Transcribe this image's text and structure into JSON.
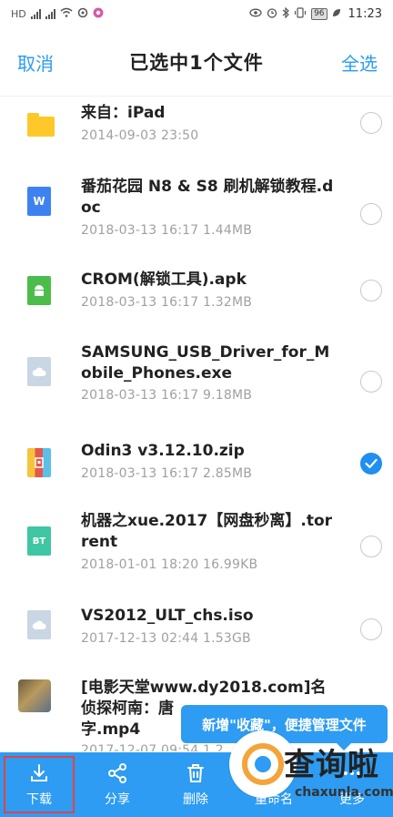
{
  "status_bar": {
    "left_indicators": [
      "HD",
      "4G",
      "4G",
      "wifi",
      "sync",
      "app"
    ],
    "battery": "96",
    "time": "11:23"
  },
  "header": {
    "cancel": "取消",
    "title": "已选中1个文件",
    "select_all": "全选"
  },
  "files": [
    {
      "name": "来自：iPad",
      "meta": "2014-09-03  23:50",
      "icon": "folder-icon",
      "selected": false
    },
    {
      "name": "番茄花园 N8 & S8 刷机解锁教程.doc",
      "meta": "2018-03-13  16:17   1.44MB",
      "icon": "doc-icon",
      "icon_label": "W",
      "selected": false
    },
    {
      "name": "CROM(解锁工具).apk",
      "meta": "2018-03-13  16:17   1.32MB",
      "icon": "android-icon",
      "selected": false
    },
    {
      "name": "SAMSUNG_USB_Driver_for_Mobile_Phones.exe",
      "meta": "2018-03-13  16:17   9.18MB",
      "icon": "cloud-file-icon",
      "selected": false
    },
    {
      "name": "Odin3 v3.12.10.zip",
      "meta": "2018-03-13  16:17   2.85MB",
      "icon": "zip-icon",
      "selected": true
    },
    {
      "name": "机器之xue.2017【网盘秒离】.torrent",
      "meta": "2018-01-01  18:20   16.99KB",
      "icon": "bt-icon",
      "icon_label": "BT",
      "selected": false
    },
    {
      "name": "VS2012_ULT_chs.iso",
      "meta": "2017-12-13  02:44   1.53GB",
      "icon": "cloud-file-icon",
      "selected": false
    },
    {
      "name": "[电影天堂www.dy2018.com]名侦探柯南：唐",
      "name2": "字.mp4",
      "meta": "2017-12-07  09:54   1.2",
      "icon": "video-thumbnail",
      "selected": false
    }
  ],
  "toast": "新增\"收藏\"，便捷管理文件",
  "toolbar": {
    "download": "下载",
    "share": "分享",
    "delete": "删除",
    "rename": "重命名",
    "more": "更多"
  },
  "watermark": {
    "text": "查询啦",
    "sub": "chaxunla.com"
  },
  "colors": {
    "accent": "#2d9cf2",
    "highlight_box": "#e34242"
  }
}
